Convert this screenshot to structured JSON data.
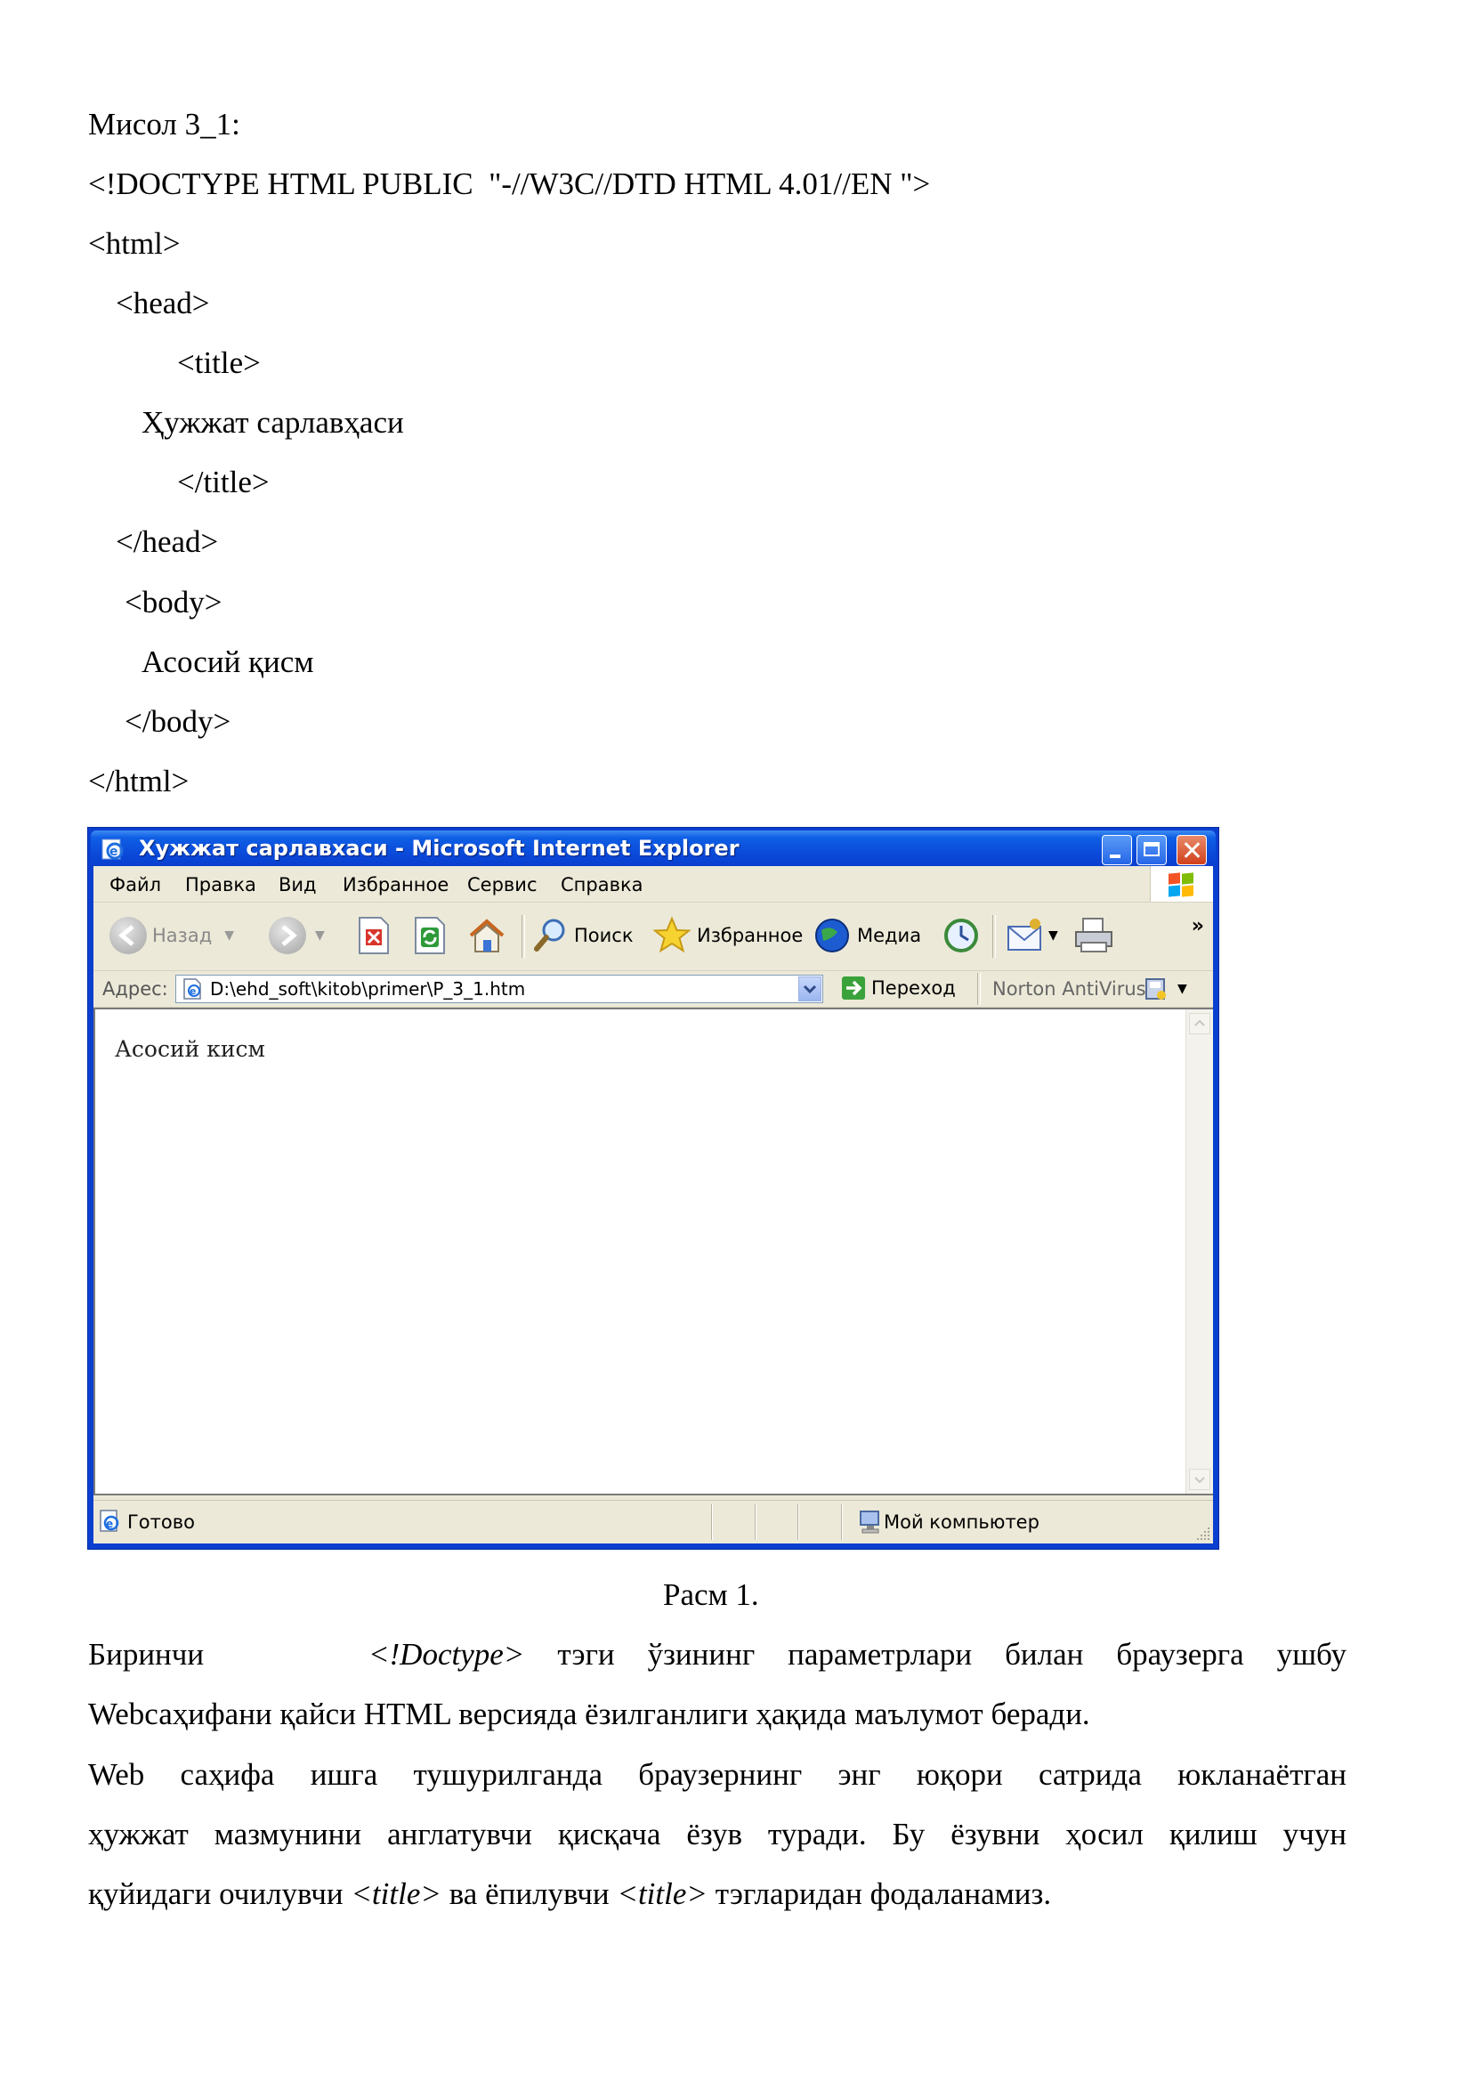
{
  "code": {
    "heading": "Мисол 3_1:",
    "lines": [
      "<!DOCTYPE HTML PUBLIC  \"-//W3C//DTD HTML 4.01//EN \">",
      "<html>",
      "<head>",
      "<title>",
      "Ҳужжат сарлавҳаси",
      "</title>",
      "</head>",
      "<body>",
      "Асосий қисм",
      "</body>",
      "</html>"
    ]
  },
  "browser": {
    "title": "Хужжат сарлавхаси - Microsoft Internet Explorer",
    "menu": [
      "Файл",
      "Правка",
      "Вид",
      "Избранное",
      "Сервис",
      "Справка"
    ],
    "toolbar": {
      "back": "Назад",
      "search": "Поиск",
      "favorites": "Избранное",
      "media": "Медиа"
    },
    "address_label": "Адрес:",
    "address_value": "D:\\ehd_soft\\kitob\\primer\\P_3_1.htm",
    "go_label": "Переход",
    "norton_label": "Norton AntiVirus",
    "page_text": "Асосий кисм",
    "status_text": "Готово",
    "status_zone": "Мой компьютер"
  },
  "caption": "Расм 1.",
  "paragraphs": {
    "p1_line1_a": "Биринчи",
    "p1_tag": "<!Doctype>",
    "p1_line1_b": "тэги ўзининг параметрлари билан браузерга ушбу",
    "p1_line2": "Webсаҳифани қайси HTML версияда ёзилганлиги ҳақида маълумот беради.",
    "p2_line1": "Web саҳифа ишга тушурилганда браузернинг энг юқори сатрида юкланаётган",
    "p2_line2": "ҳужжат мазмунини англатувчи қисқача ёзув туради. Бу ёзувни ҳосил қилиш учун",
    "p2_line3_a": "қуйидаги очилувчи",
    "p2_tag1": "<title>",
    "p2_line3_b": "ва ёпилувчи",
    "p2_tag2": "<title>",
    "p2_line3_c": "тэгларидан фодаланамиз."
  }
}
